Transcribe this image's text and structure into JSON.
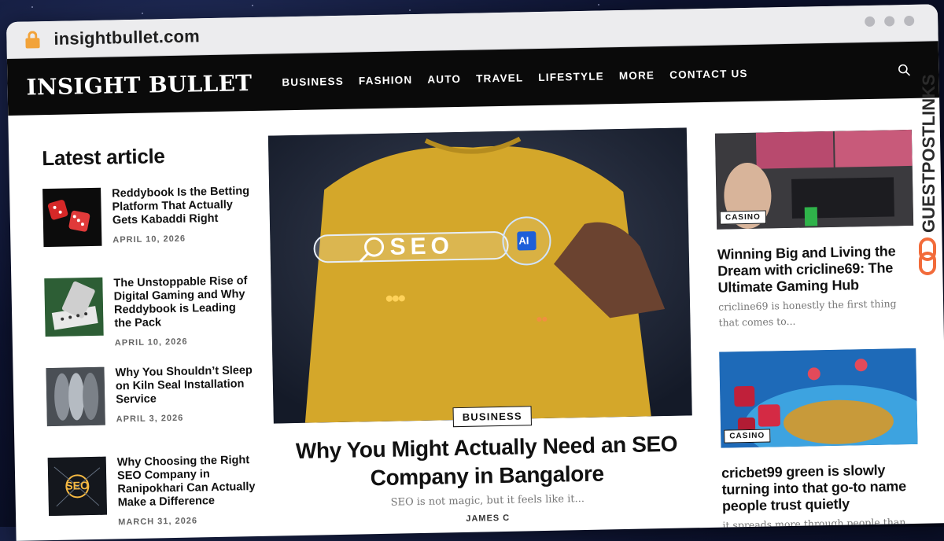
{
  "browser": {
    "url": "insightbullet.com"
  },
  "site": {
    "logo": "INSIGHT BULLET",
    "menu": [
      "BUSINESS",
      "FASHION",
      "AUTO",
      "TRAVEL",
      "LIFESTYLE",
      "MORE",
      "CONTACT US"
    ]
  },
  "latest": {
    "heading": "Latest article",
    "items": [
      {
        "title": "Reddybook Is the Betting Platform That Actually Gets Kabaddi Right",
        "date": "APRIL 10, 2026"
      },
      {
        "title": "The Unstoppable Rise of Digital Gaming and Why Reddybook is Leading the Pack",
        "date": "APRIL 10, 2026"
      },
      {
        "title": "Why You Shouldn’t Sleep on Kiln Seal Installation Service",
        "date": "APRIL 3, 2026"
      },
      {
        "title": "Why Choosing the Right SEO Company in Ranipokhari Can Actually Make a Difference",
        "date": "MARCH 31, 2026"
      }
    ]
  },
  "hero": {
    "image_text": {
      "seo": "SEO",
      "ai": "AI"
    },
    "category": "BUSINESS",
    "title": "Why You Might Actually Need an SEO Company in Bangalore",
    "excerpt": "SEO is not magic, but it feels like it...",
    "author": "JAMES C"
  },
  "sidebar": [
    {
      "category": "CASINO",
      "title": "Winning Big and Living the Dream with cricline69: The Ultimate Gaming Hub",
      "excerpt": "cricline69 is honestly the first thing that comes to..."
    },
    {
      "category": "CASINO",
      "title": "cricbet99 green is slowly turning into that go-to name people trust quietly",
      "excerpt": "it spreads more through people than"
    }
  ],
  "watermark": "GUESTPOSTLINKS",
  "colors": {
    "accent": "#f2a33a",
    "navbar": "#0a0a0a",
    "watermark": "#2b2b2b",
    "watermark_logo": "#f26b3a"
  }
}
